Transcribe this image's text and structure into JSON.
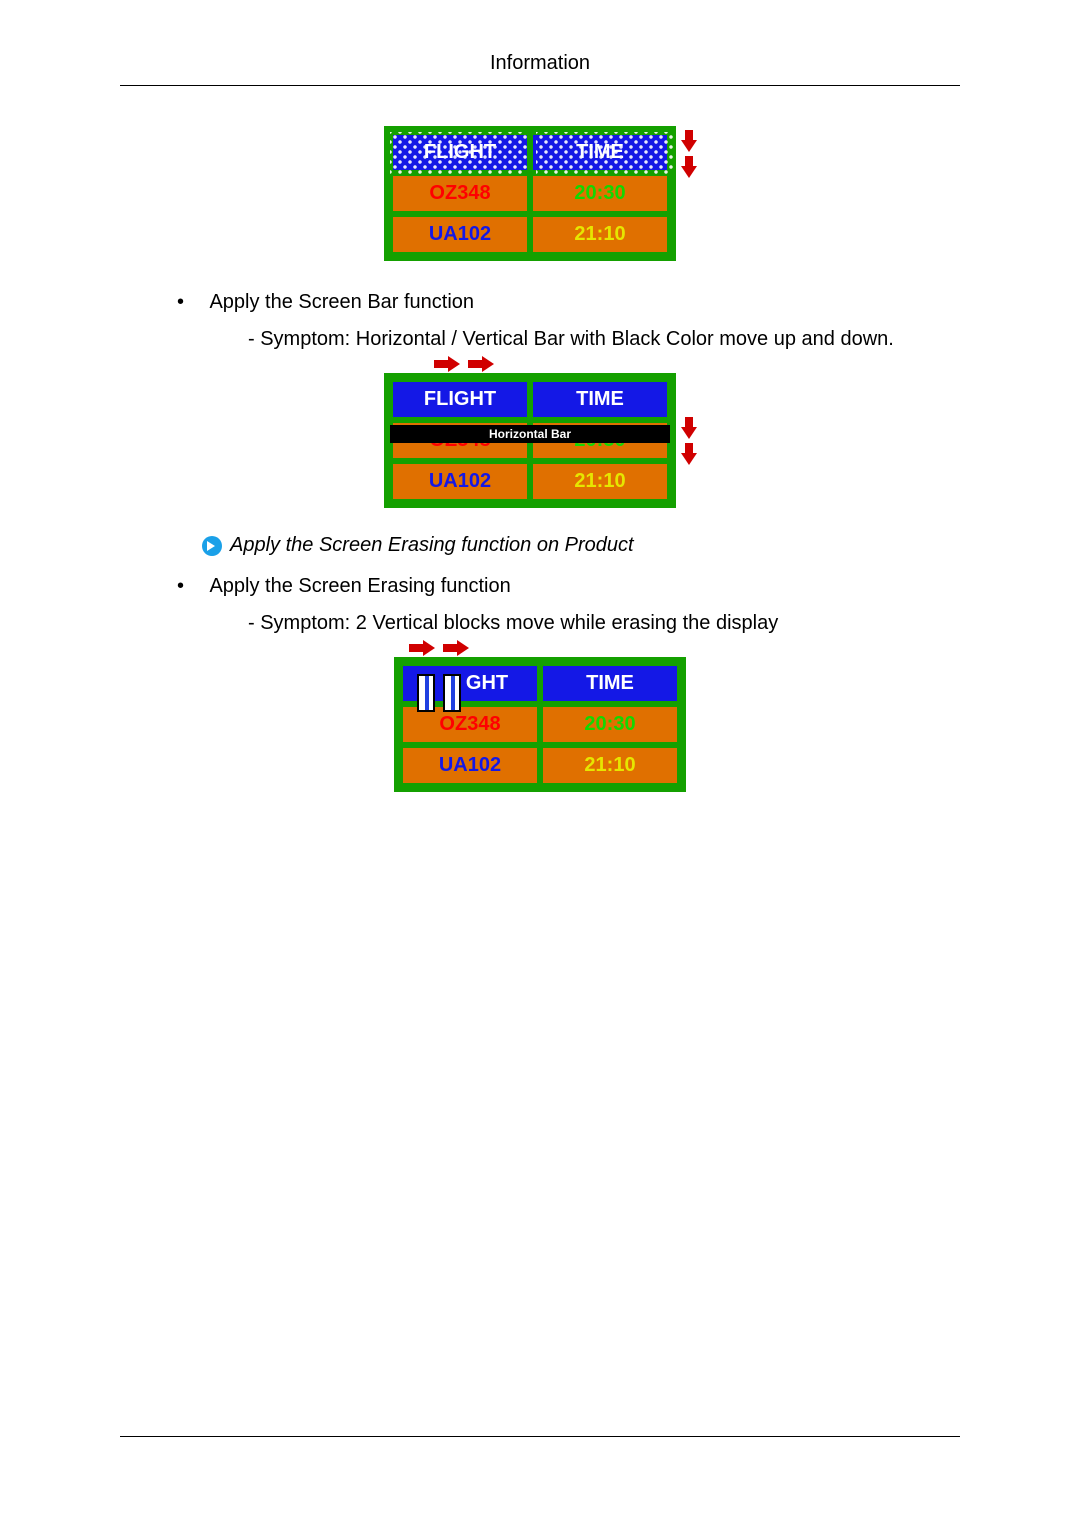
{
  "page": {
    "header": "Information"
  },
  "board": {
    "headers": {
      "flight": "FLIGHT",
      "time": "TIME"
    },
    "rows": [
      {
        "flight": "OZ348",
        "time": "20:30"
      },
      {
        "flight": "UA102",
        "time": "21:10"
      }
    ]
  },
  "fig2": {
    "bar_label": "Horizontal Bar"
  },
  "fig3": {
    "header_partial": "GHT"
  },
  "text": {
    "bullet1": "Apply the Screen Bar function",
    "bullet1_sub": "- Symptom: Horizontal / Vertical Bar with Black Color move up and down.",
    "note": "Apply the Screen Erasing function on Product",
    "bullet2": "Apply the Screen Erasing function",
    "bullet2_sub": "- Symptom: 2 Vertical blocks move while erasing the display"
  }
}
